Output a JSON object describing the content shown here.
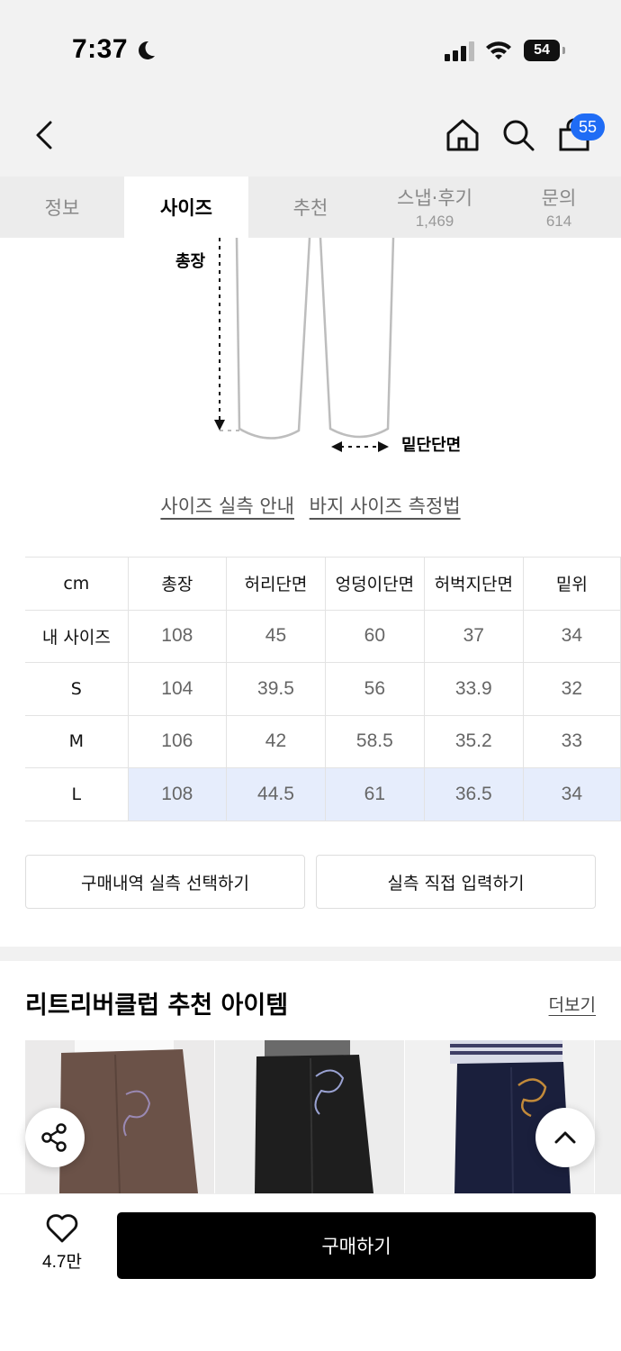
{
  "status_bar": {
    "time": "7:37",
    "battery": "54",
    "icons": [
      "moon-icon",
      "signal-icon",
      "wifi-icon",
      "battery-icon"
    ]
  },
  "header": {
    "cart_count": "55",
    "icons": [
      "back-icon",
      "home-icon",
      "search-icon",
      "bag-icon"
    ]
  },
  "tabs": [
    {
      "label": "정보",
      "count": ""
    },
    {
      "label": "사이즈",
      "count": ""
    },
    {
      "label": "추천",
      "count": ""
    },
    {
      "label": "스냅·후기",
      "count": "1,469"
    },
    {
      "label": "문의",
      "count": "614"
    }
  ],
  "diagram": {
    "total_length_label": "총장",
    "hem_label": "밑단단면"
  },
  "guide_links": {
    "measure_guide": "사이즈 실측 안내",
    "pants_method": "바지 사이즈 측정법"
  },
  "size_table": {
    "headers": [
      "cm",
      "총장",
      "허리단면",
      "엉덩이단면",
      "허벅지단면",
      "밑위"
    ],
    "rows": [
      {
        "label": "내 사이즈",
        "values": [
          "108",
          "45",
          "60",
          "37",
          "34"
        ]
      },
      {
        "label": "S",
        "values": [
          "104",
          "39.5",
          "56",
          "33.9",
          "32"
        ]
      },
      {
        "label": "M",
        "values": [
          "106",
          "42",
          "58.5",
          "35.2",
          "33"
        ]
      },
      {
        "label": "L",
        "values": [
          "108",
          "44.5",
          "61",
          "36.5",
          "34"
        ]
      }
    ]
  },
  "actions": {
    "select_history": "구매내역 실측 선택하기",
    "manual_input": "실측 직접 입력하기"
  },
  "recommend": {
    "title": "리트리버클럽 추천 아이템",
    "more": "더보기"
  },
  "colors": {
    "accent": "#1f6cf5",
    "highlight": "#e6edfc",
    "buy": "#000000"
  },
  "bottom": {
    "like_count": "4.7만",
    "buy_label": "구매하기"
  }
}
